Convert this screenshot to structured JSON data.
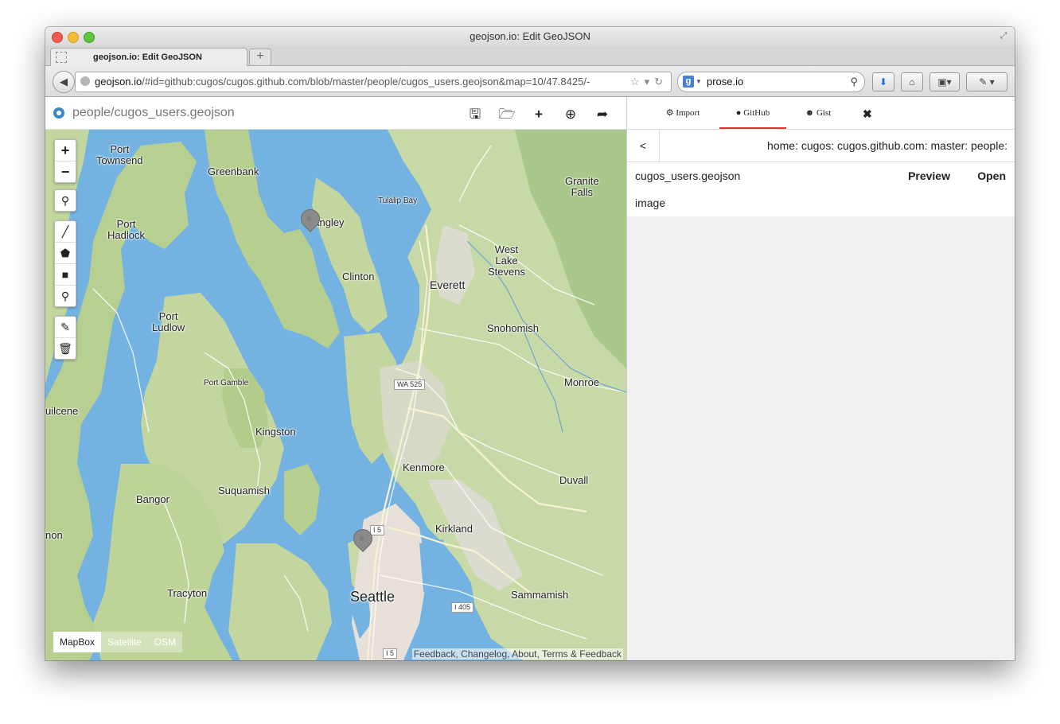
{
  "window": {
    "title": "geojson.io: Edit GeoJSON"
  },
  "tabs": [
    {
      "label": "geojson.io: Edit GeoJSON"
    }
  ],
  "toolbar": {
    "url_host": "geojson.io",
    "url_rest": "/#id=github:cugos/cugos.github.com/blob/master/people/cugos_users.geojson&map=10/47.8425/-",
    "search_value": "prose.io",
    "search_engine_icon": "g"
  },
  "app": {
    "file_title": "people/cugos_users.geojson",
    "top_icons": [
      "save-icon",
      "open-icon",
      "add-icon",
      "download-icon",
      "share-icon"
    ]
  },
  "map": {
    "labels": {
      "port_townsend": "Port\nTownsend",
      "greenbank": "Greenbank",
      "port_hadlock": "Port\nHadlock",
      "langley": "Langley",
      "tulalip_bay": "Tulalip Bay",
      "granite_falls": "Granite\nFalls",
      "clinton": "Clinton",
      "west_lake_stevens": "West\nLake\nStevens",
      "everett": "Everett",
      "port_ludlow": "Port\nLudlow",
      "snohomish": "Snohomish",
      "port_gamble": "Port Gamble",
      "monroe": "Monroe",
      "quilcene": "uilcene",
      "kingston": "Kingston",
      "kenmore": "Kenmore",
      "duvall": "Duvall",
      "bangor": "Bangor",
      "suquamish": "Suquamish",
      "kirkland": "Kirkland",
      "brinnon": "non",
      "tracyton": "Tracyton",
      "seattle": "Seattle",
      "sammamish": "Sammamish"
    },
    "shields": {
      "wa525": "WA 525",
      "i5_north": "I 5",
      "i405": "I 405",
      "i5_south": "I 5",
      "i405_south": "I 405"
    },
    "layers": [
      "MapBox",
      "Satellite",
      "OSM"
    ],
    "active_layer": "MapBox",
    "attribution": "Feedback, Changelog, About, Terms & Feedback",
    "colors": {
      "water": "#74b3e1",
      "land": "#c8d9a8",
      "forest": "#a9c78a",
      "urban": "#e6e0d8"
    }
  },
  "panel": {
    "tabs": [
      {
        "label": "Import",
        "icon": "gear-icon"
      },
      {
        "label": "GitHub",
        "icon": "github-icon"
      },
      {
        "label": "Gist",
        "icon": "octocat-icon"
      }
    ],
    "active_tab": "GitHub",
    "back": "<",
    "breadcrumb": "home: cugos: cugos.github.com: master: people:",
    "file": {
      "name": "cugos_users.geojson",
      "preview": "Preview",
      "open": "Open"
    },
    "folder": "image",
    "accent": "#e0302a"
  }
}
